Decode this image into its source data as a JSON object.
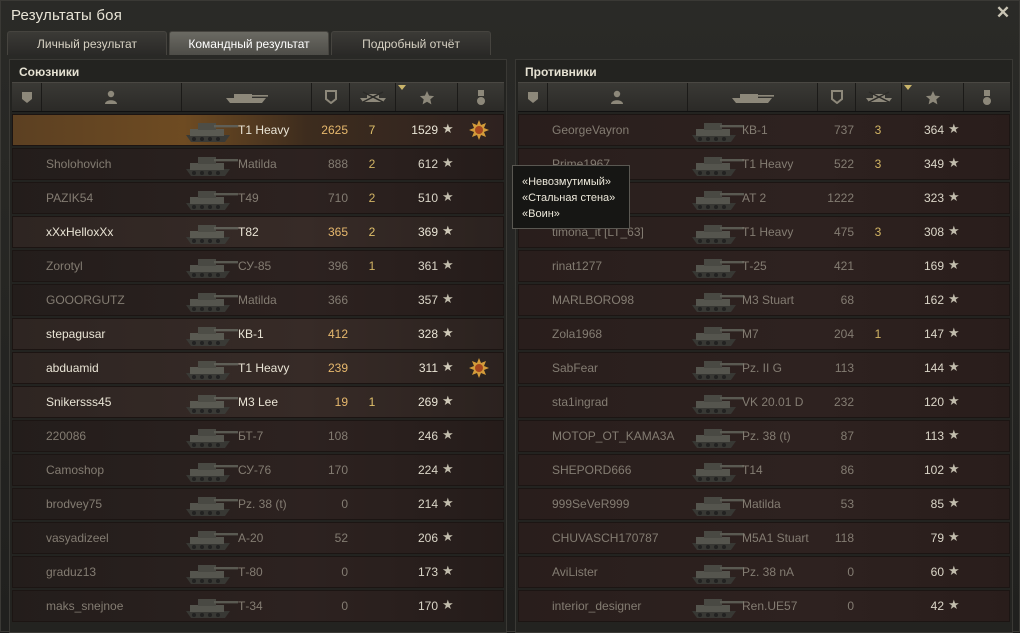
{
  "window": {
    "title": "Результаты боя"
  },
  "tabs": [
    {
      "label": "Личный результат",
      "active": false
    },
    {
      "label": "Командный результат",
      "active": true
    },
    {
      "label": "Подробный отчёт",
      "active": false
    }
  ],
  "allies": {
    "title": "Союзники",
    "rows": [
      {
        "name": "",
        "tank": "T1 Heavy",
        "damage": "2625",
        "kills": "7",
        "xp": "1529",
        "state": "me",
        "medal": true
      },
      {
        "name": "Sholohovich",
        "tank": "Matilda",
        "damage": "888",
        "kills": "2",
        "xp": "612",
        "state": "dead"
      },
      {
        "name": "PAZIK54",
        "tank": "T49",
        "damage": "710",
        "kills": "2",
        "xp": "510",
        "state": "dead"
      },
      {
        "name": "xXxHelloxXx",
        "tank": "T82",
        "damage": "365",
        "kills": "2",
        "xp": "369",
        "state": "alive"
      },
      {
        "name": "Zorotyl",
        "tank": "СУ-85",
        "damage": "396",
        "kills": "1",
        "xp": "361",
        "state": "dead"
      },
      {
        "name": "GOOORGUTZ",
        "tank": "Matilda",
        "damage": "366",
        "kills": "",
        "xp": "357",
        "state": "dead"
      },
      {
        "name": "stepagusar",
        "tank": "КВ-1",
        "damage": "412",
        "kills": "",
        "xp": "328",
        "state": "alive"
      },
      {
        "name": "abduamid",
        "tank": "T1 Heavy",
        "damage": "239",
        "kills": "",
        "xp": "311",
        "state": "alive",
        "medal": true
      },
      {
        "name": "Snikersss45",
        "tank": "M3 Lee",
        "damage": "19",
        "kills": "1",
        "xp": "269",
        "state": "alive"
      },
      {
        "name": "220086",
        "tank": "БТ-7",
        "damage": "108",
        "kills": "",
        "xp": "246",
        "state": "dead"
      },
      {
        "name": "Camoshop",
        "tank": "СУ-76",
        "damage": "170",
        "kills": "",
        "xp": "224",
        "state": "dead"
      },
      {
        "name": "brodvey75",
        "tank": "Pz. 38 (t)",
        "damage": "0",
        "kills": "",
        "xp": "214",
        "state": "dead"
      },
      {
        "name": "vasyadizeel",
        "tank": "А-20",
        "damage": "52",
        "kills": "",
        "xp": "206",
        "state": "dead"
      },
      {
        "name": "graduz13",
        "tank": "Т-80",
        "damage": "0",
        "kills": "",
        "xp": "173",
        "state": "dead"
      },
      {
        "name": "maks_snejnoe",
        "tank": "Т-34",
        "damage": "0",
        "kills": "",
        "xp": "170",
        "state": "dead"
      }
    ]
  },
  "enemies": {
    "title": "Противники",
    "rows": [
      {
        "name": "GeorgeVayron",
        "tank": "КВ-1",
        "damage": "737",
        "kills": "3",
        "xp": "364",
        "state": "dead"
      },
      {
        "name": "Prime1967",
        "tank": "T1 Heavy",
        "damage": "522",
        "kills": "3",
        "xp": "349",
        "state": "dead"
      },
      {
        "name": "",
        "tank": "AT 2",
        "damage": "1222",
        "kills": "",
        "xp": "323",
        "state": "dead"
      },
      {
        "name": "timona_it [LT_63]",
        "tank": "T1 Heavy",
        "damage": "475",
        "kills": "3",
        "xp": "308",
        "state": "dead"
      },
      {
        "name": "rinat1277",
        "tank": "Т-25",
        "damage": "421",
        "kills": "",
        "xp": "169",
        "state": "dead"
      },
      {
        "name": "MARLBORO98",
        "tank": "M3 Stuart",
        "damage": "68",
        "kills": "",
        "xp": "162",
        "state": "dead"
      },
      {
        "name": "Zola1968",
        "tank": "M7",
        "damage": "204",
        "kills": "1",
        "xp": "147",
        "state": "dead"
      },
      {
        "name": "SabFear",
        "tank": "Pz. II G",
        "damage": "113",
        "kills": "",
        "xp": "144",
        "state": "dead"
      },
      {
        "name": "sta1ingrad",
        "tank": "VK 20.01 D",
        "damage": "232",
        "kills": "",
        "xp": "120",
        "state": "dead"
      },
      {
        "name": "MOTOP_OT_KAMA3A",
        "tank": "Pz. 38 (t)",
        "damage": "87",
        "kills": "",
        "xp": "113",
        "state": "dead"
      },
      {
        "name": "SHEPORD666",
        "tank": "T14",
        "damage": "86",
        "kills": "",
        "xp": "102",
        "state": "dead"
      },
      {
        "name": "999SeVeR999",
        "tank": "Matilda",
        "damage": "53",
        "kills": "",
        "xp": "85",
        "state": "dead"
      },
      {
        "name": "CHUVASCH170787",
        "tank": "M5A1 Stuart",
        "damage": "118",
        "kills": "",
        "xp": "79",
        "state": "dead"
      },
      {
        "name": "AviLister",
        "tank": "Pz. 38 nA",
        "damage": "0",
        "kills": "",
        "xp": "60",
        "state": "dead"
      },
      {
        "name": "interior_designer",
        "tank": "Ren.UE57",
        "damage": "0",
        "kills": "",
        "xp": "42",
        "state": "dead"
      }
    ]
  },
  "tooltip": {
    "lines": [
      "«Невозмутимый»",
      "«Стальная стена»",
      "«Воин»"
    ]
  },
  "icons": {
    "xp_star": "★",
    "close": "✕"
  },
  "colors": {
    "highlight_row": "#6e4b22",
    "damage_alive": "#e6b86d",
    "kills": "#e0c06a"
  }
}
